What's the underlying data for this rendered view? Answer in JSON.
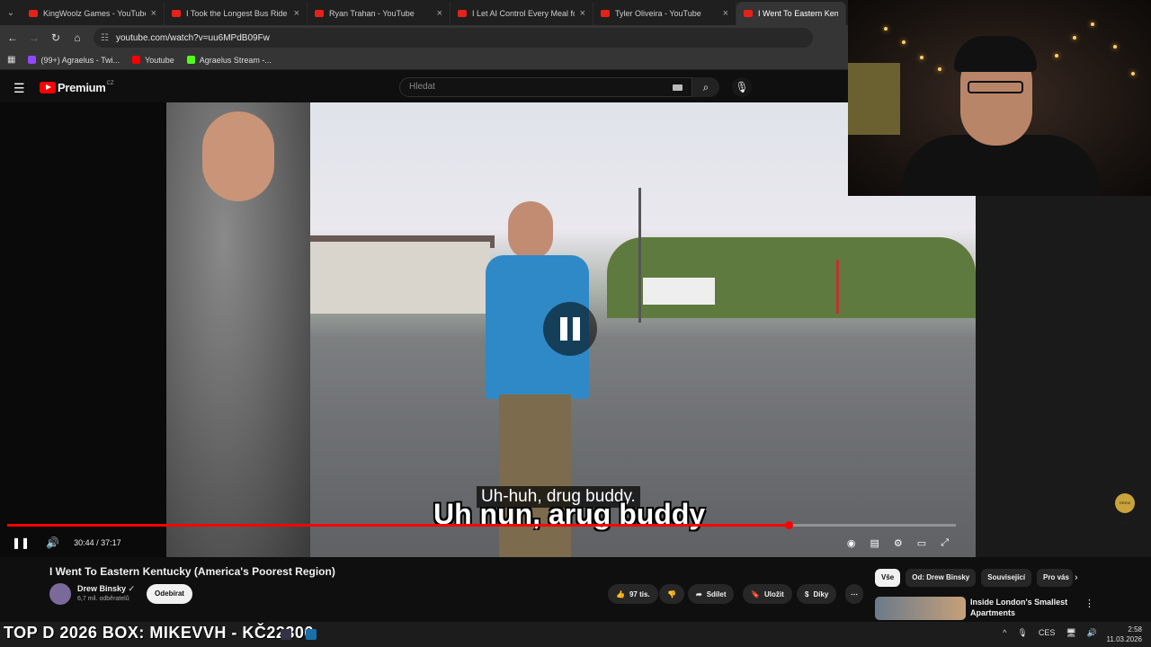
{
  "browser": {
    "tabs": [
      {
        "title": "KingWoolz Games - YouTube",
        "active": false
      },
      {
        "title": "I Took the Longest Bus Ride in ...",
        "active": false
      },
      {
        "title": "Ryan Trahan - YouTube",
        "active": false
      },
      {
        "title": "I Let AI Control Every Meal for ...",
        "active": false
      },
      {
        "title": "Tyler Oliveira - YouTube",
        "active": false
      },
      {
        "title": "I Went To Eastern Kentucky",
        "active": true
      }
    ],
    "url": "youtube.com/watch?v=uu6MPdB09Fw",
    "bookmarks": [
      {
        "label": "(99+) Agraelus - Twi...",
        "color": "#9146ff"
      },
      {
        "label": "Youtube",
        "color": "#ff0000"
      },
      {
        "label": "Agraelus Stream -...",
        "color": "#53fc18"
      }
    ]
  },
  "youtube": {
    "logo_text": "Premium",
    "logo_region": "CZ",
    "search_placeholder": "Hledat"
  },
  "player": {
    "subtitle_small": "Uh-huh, drug buddy.",
    "subtitle_big": "Uh nun, arug buddy",
    "current_time": "30:44",
    "duration": "37:17",
    "time_display": "30:44 / 37:17",
    "progress_fraction": 0.824,
    "watermark": "DREW BINSKY"
  },
  "video": {
    "title": "I Went To Eastern Kentucky (America's Poorest Region)",
    "channel": "Drew Binsky",
    "subscribers": "6,7 mil. odběratelů",
    "subscribe_label": "Odebírat",
    "likes": "97 tis.",
    "share_label": "Sdílet",
    "save_label": "Uložit",
    "thanks_label": "Díky"
  },
  "sidebar": {
    "chips": [
      {
        "label": "Vše",
        "selected": true
      },
      {
        "label": "Od: Drew Binsky",
        "selected": false
      },
      {
        "label": "Související",
        "selected": false
      },
      {
        "label": "Pro vás",
        "selected": false
      }
    ],
    "recommendation_title": "Inside London's Smallest Apartments"
  },
  "taskbar": {
    "ticker": "TOP D 2026 BOX: MIKEVVH - KČ22300",
    "language": "CES",
    "time": "2:58",
    "date": "11.03.2026"
  }
}
